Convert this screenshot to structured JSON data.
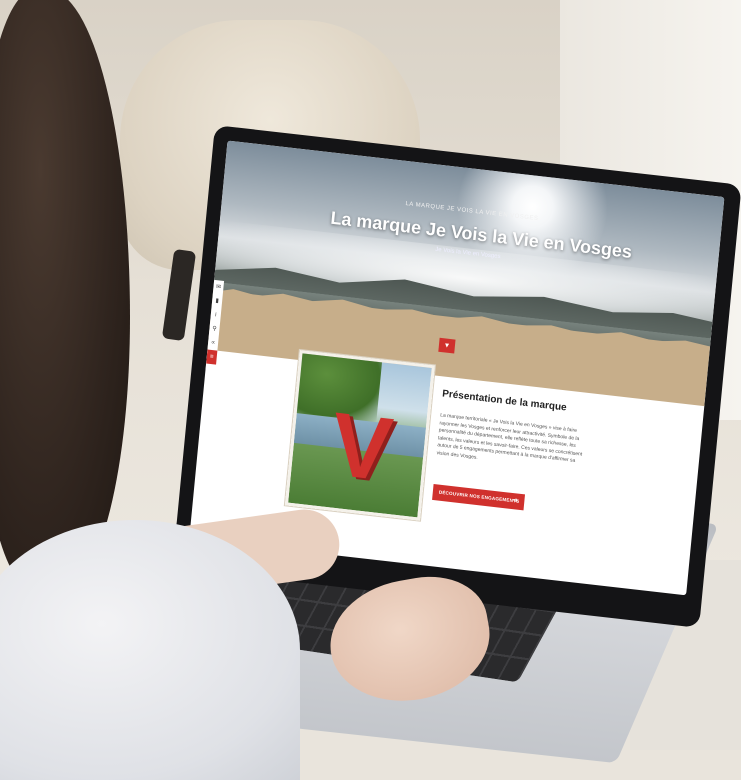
{
  "hero": {
    "kicker": "La marque Je Vois la Vie en Vosges",
    "title": "La marque Je Vois la Vie en Vosges",
    "subtitle": "Je Vois la Vie en Vosges",
    "scroll_icon": "chevron-down-icon"
  },
  "side_tools": {
    "icons": [
      "mail-icon",
      "document-icon",
      "info-icon",
      "search-icon",
      "share-icon",
      "menu-icon"
    ]
  },
  "presentation": {
    "title": "Présentation de la marque",
    "body": "La marque territoriale « Je Vois la Vie en Vosges » vise à faire rayonner les Vosges et renforcer leur attractivité. Symbole de la personnalité du département, elle reflète toute sa richesse, les talents, les valeurs et les savoir-faire. Ces valeurs se concrétisent autour de 5 engagements permettant à la marque d'affirmer sa vision des Vosges.",
    "cta_label": "Découvrir nos engagements",
    "cta_icon": "arrow-right-icon",
    "photo_letter": "V"
  },
  "colors": {
    "accent": "#d0312d",
    "kraft": "#c7ae8a"
  }
}
